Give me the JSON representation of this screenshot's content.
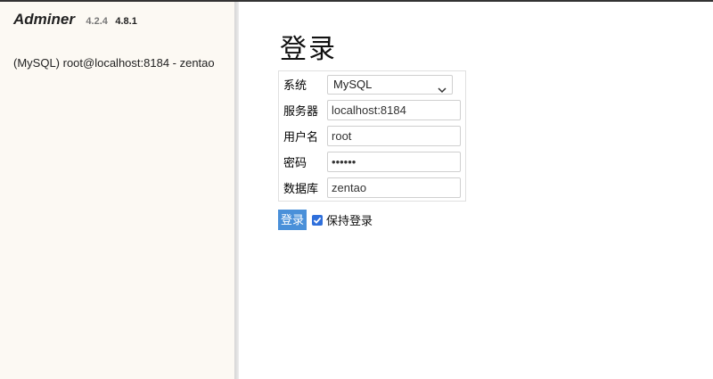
{
  "sidebar": {
    "brand": "Adminer",
    "version_current": "4.2.4",
    "version_new": "4.8.1",
    "connection": "(MySQL) root@localhost:8184 - zentao"
  },
  "main": {
    "title": "登录",
    "form": {
      "system_label": "系统",
      "system_value": "MySQL",
      "server_label": "服务器",
      "server_value": "localhost:8184",
      "username_label": "用户名",
      "username_value": "root",
      "password_label": "密码",
      "password_value": "••••••",
      "database_label": "数据库",
      "database_value": "zentao"
    },
    "login_button": "登录",
    "remember_label": "保持登录",
    "remember_checked": true
  },
  "colors": {
    "accent": "#4a90d9",
    "checkbox": "#2f6fdb",
    "sidebar_bg": "#fcf9f3"
  },
  "icons": {
    "dropdown": "chevron-down-icon",
    "check": "check-icon"
  }
}
